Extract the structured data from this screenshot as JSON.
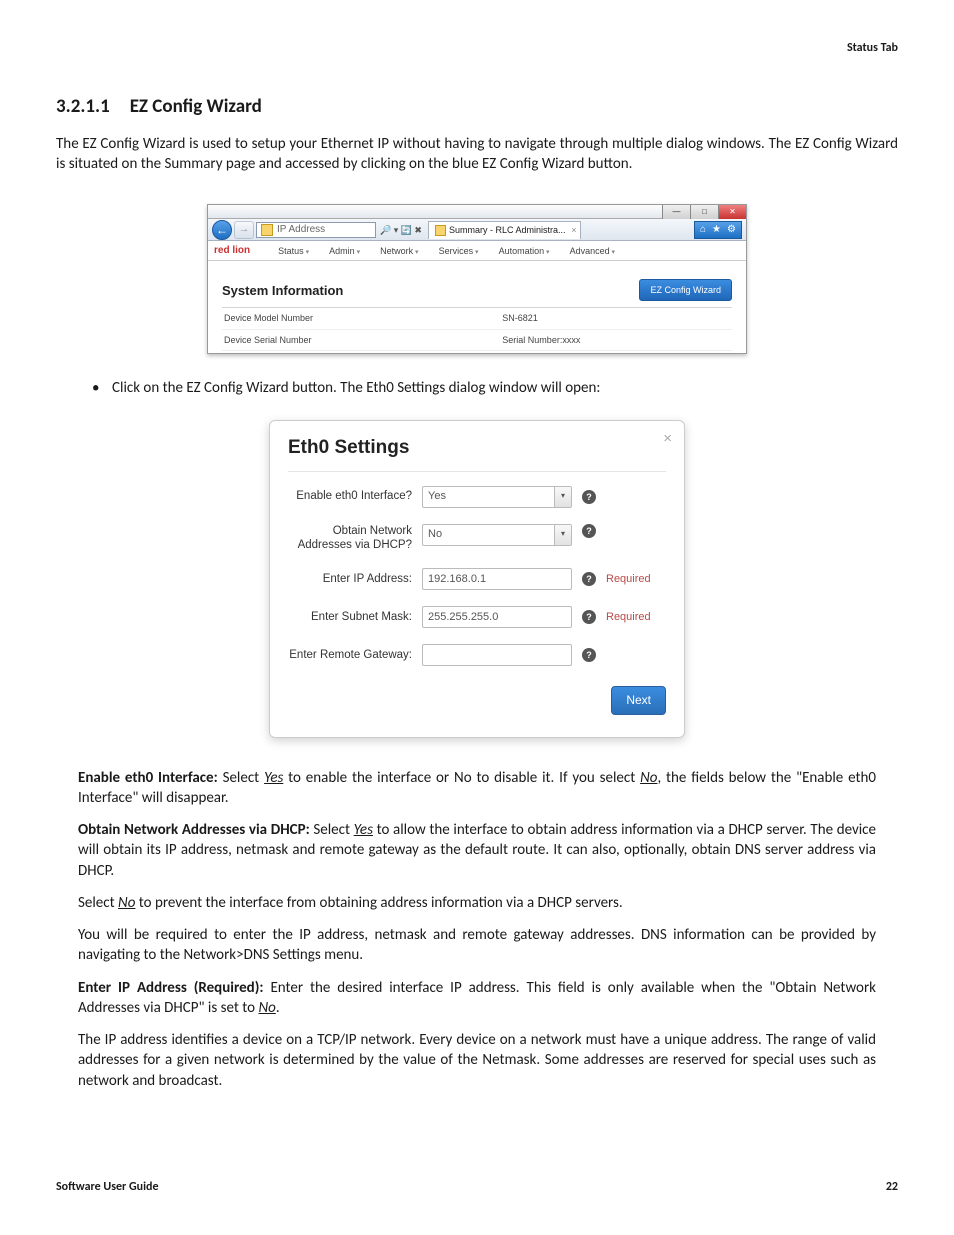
{
  "header": {
    "section": "Status Tab"
  },
  "title": {
    "num": "3.2.1.1",
    "text": "EZ Config Wizard"
  },
  "intro": "The EZ Config Wizard is used to setup your Ethernet IP without having to navigate through multiple dialog windows. The EZ Config Wizard is situated on the Summary page and accessed by clicking on the blue EZ Config Wizard button.",
  "bullet_text": "Click on the EZ Config Wizard button. The Eth0 Settings dialog window will open:",
  "browser": {
    "address": "IP Address",
    "search_icons": "🔎 ▾ 🔄 ✖",
    "tab": "Summary - RLC Administra...",
    "controls": {
      "home": "⌂",
      "star": "★",
      "gear": "⚙"
    },
    "brand": "red lion",
    "menu": [
      "Status",
      "Admin",
      "Network",
      "Services",
      "Automation",
      "Advanced"
    ],
    "panel_title": "System Information",
    "ez_btn": "EZ Config Wizard",
    "rows": [
      {
        "lbl": "Device Model Number",
        "val": "SN-6821"
      },
      {
        "lbl": "Device Serial Number",
        "val": "Serial Number:xxxx"
      }
    ]
  },
  "dialog": {
    "title": "Eth0 Settings",
    "close": "×",
    "fields": {
      "enable": {
        "label": "Enable eth0 Interface?",
        "value": "Yes"
      },
      "dhcp": {
        "label": "Obtain Network Addresses via DHCP?",
        "value": "No"
      },
      "ip": {
        "label": "Enter IP Address:",
        "value": "192.168.0.1",
        "extra": "Required"
      },
      "mask": {
        "label": "Enter Subnet Mask:",
        "value": "255.255.255.0",
        "extra": "Required"
      },
      "gateway": {
        "label": "Enter Remote Gateway:",
        "value": ""
      }
    },
    "next": "Next",
    "help": "?"
  },
  "para": {
    "p1a": "Enable eth0 Interface: ",
    "p1b": "Select ",
    "p1c": "Yes",
    "p1d": " to enable the interface or No to disable it. If you select ",
    "p1e": "No",
    "p1f": ", the fields below the \"Enable eth0 Interface\" will disappear.",
    "p2a": "Obtain Network Addresses via DHCP: ",
    "p2b": "Select ",
    "p2c": "Yes",
    "p2d": " to allow the interface to obtain address information via a DHCP server. The device will obtain its IP address, netmask and remote gateway as the default route. It can also, optionally, obtain DNS server address via DHCP.",
    "p3a": "Select ",
    "p3b": "No",
    "p3c": " to prevent the interface from obtaining address information via a DHCP servers.",
    "p4": "You will be required to enter the IP address, netmask and remote gateway addresses. DNS information can be provided by navigating to the Network>DNS Settings menu.",
    "p5a": "Enter IP Address (Required): ",
    "p5b": "Enter the desired interface IP address. This field is only available when the \"Obtain Network Addresses via DHCP\" is set to ",
    "p5c": "No",
    "p5d": ".",
    "p6": "The IP address identifies a device on a TCP/IP network. Every device on a network must have a unique address. The range of valid addresses for a given network is determined by the value of the Netmask. Some addresses are reserved for special uses such as network and broadcast."
  },
  "footer": {
    "left": "Software User Guide",
    "right": "22"
  }
}
